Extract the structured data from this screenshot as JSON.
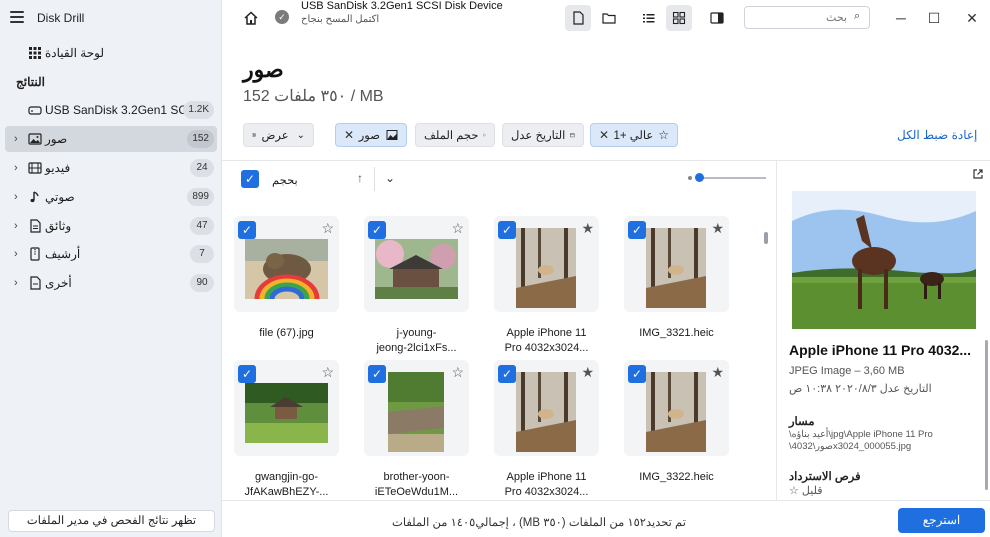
{
  "app": {
    "title": "Disk Drill"
  },
  "sidebar": {
    "dashboard_label": "لوحة القيادة",
    "results_heading": "النتائج",
    "device": {
      "label": "USB  SanDisk 3.2Gen1 SCS...",
      "count": "1.2K"
    },
    "items": [
      {
        "label": "صور",
        "count": "152",
        "icon": "picture-icon"
      },
      {
        "label": "فيديو",
        "count": "24",
        "icon": "film-icon"
      },
      {
        "label": "صوتي",
        "count": "899",
        "icon": "music-note-icon"
      },
      {
        "label": "وثائق",
        "count": "47",
        "icon": "document-icon"
      },
      {
        "label": "أرشيف",
        "count": "7",
        "icon": "archive-icon"
      },
      {
        "label": "أخرى",
        "count": "90",
        "icon": "file-icon"
      }
    ],
    "footer_button": "تظهر نتائج الفحص في مدير الملفات"
  },
  "titlebar": {
    "device_name": "USB  SanDisk 3.2Gen1 SCSI Disk Device",
    "device_status": "اكتمل المسح بنجاح",
    "search_placeholder": "بحث"
  },
  "header": {
    "title": "صور",
    "summary": "152 ٣٥٠ ملفات / MB"
  },
  "filters": {
    "view_label": "عرض",
    "photos_label": "صور",
    "file_size_label": "حجم الملف",
    "date_modified_label": "التاريخ عدل",
    "rating_label": "عالي +1",
    "reset_label": "إعادة ضبط الكل"
  },
  "sort": {
    "label": "بحجم"
  },
  "files": [
    {
      "name_line1": "file (67).jpg",
      "name_line2": "",
      "thumb": "cat"
    },
    {
      "name_line1": "j-young-",
      "name_line2": "jeong-2lci1xFs...",
      "thumb": "house"
    },
    {
      "name_line1": "Apple iPhone 11",
      "name_line2": "Pro 4032x3024...",
      "thumb": "dog"
    },
    {
      "name_line1": "IMG_3321.heic",
      "name_line2": "",
      "thumb": "dog"
    },
    {
      "name_line1": "gwangjin-go-",
      "name_line2": "JfAKawBhEZY-...",
      "thumb": "pavilion"
    },
    {
      "name_line1": "brother-yoon-",
      "name_line2": "iETeOeWdu1M...",
      "thumb": "wall"
    },
    {
      "name_line1": "Apple iPhone 11",
      "name_line2": "Pro 4032x3024...",
      "thumb": "dog"
    },
    {
      "name_line1": "IMG_3322.heic",
      "name_line2": "",
      "thumb": "dog"
    }
  ],
  "preview": {
    "name": "Apple iPhone 11 Pro 4032...",
    "type": "JPEG Image – 3,60 MB",
    "date": "التاريخ عدل ٢٠٢٠/٨/٣ ١٠:٣٨ ص",
    "path_label": "مسار",
    "path_line1": "\\أعيد بناؤه\\jpg\\Apple iPhone 11 Pro",
    "path_line2": "\\صور\\4032x3024_000055.jpg",
    "chances_label": "فرص الاسترداد",
    "chances_value": "قليل"
  },
  "bottom": {
    "summary": "إجمالي١٤٠٥ من الملفات ، (MB تم تحديد١٥٢ من الملفات (٣٥٠",
    "recover_label": "استرجع"
  },
  "colors": {
    "accent": "#1f6fe0",
    "sidebar_bg": "#eef1f6"
  }
}
